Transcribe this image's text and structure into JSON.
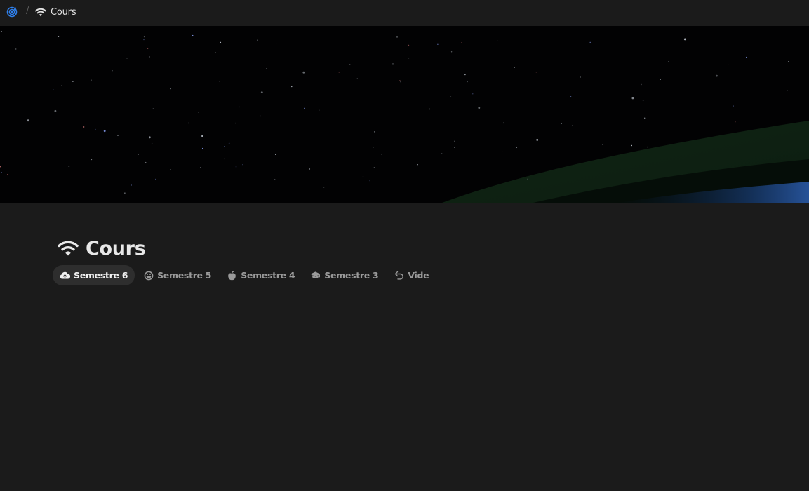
{
  "breadcrumb": {
    "logo_icon": "target-icon",
    "separator": "/",
    "page_icon": "wifi-icon",
    "page_label": "Cours"
  },
  "page": {
    "title_icon": "wifi-icon",
    "title": "Cours"
  },
  "tabs": [
    {
      "label": "Semestre 6",
      "icon": "cloud-upload-icon",
      "active": true
    },
    {
      "label": "Semestre 5",
      "icon": "smiley-icon",
      "active": false
    },
    {
      "label": "Semestre 4",
      "icon": "apple-icon",
      "active": false
    },
    {
      "label": "Semestre 3",
      "icon": "graduation-cap-icon",
      "active": false
    },
    {
      "label": "Vide",
      "icon": "undo-icon",
      "active": false
    }
  ],
  "colors": {
    "background": "#1b1b1b",
    "active_tab": "#2e2e2e",
    "logo": "#2f80ed",
    "inactive_text": "#9a9a9a"
  }
}
